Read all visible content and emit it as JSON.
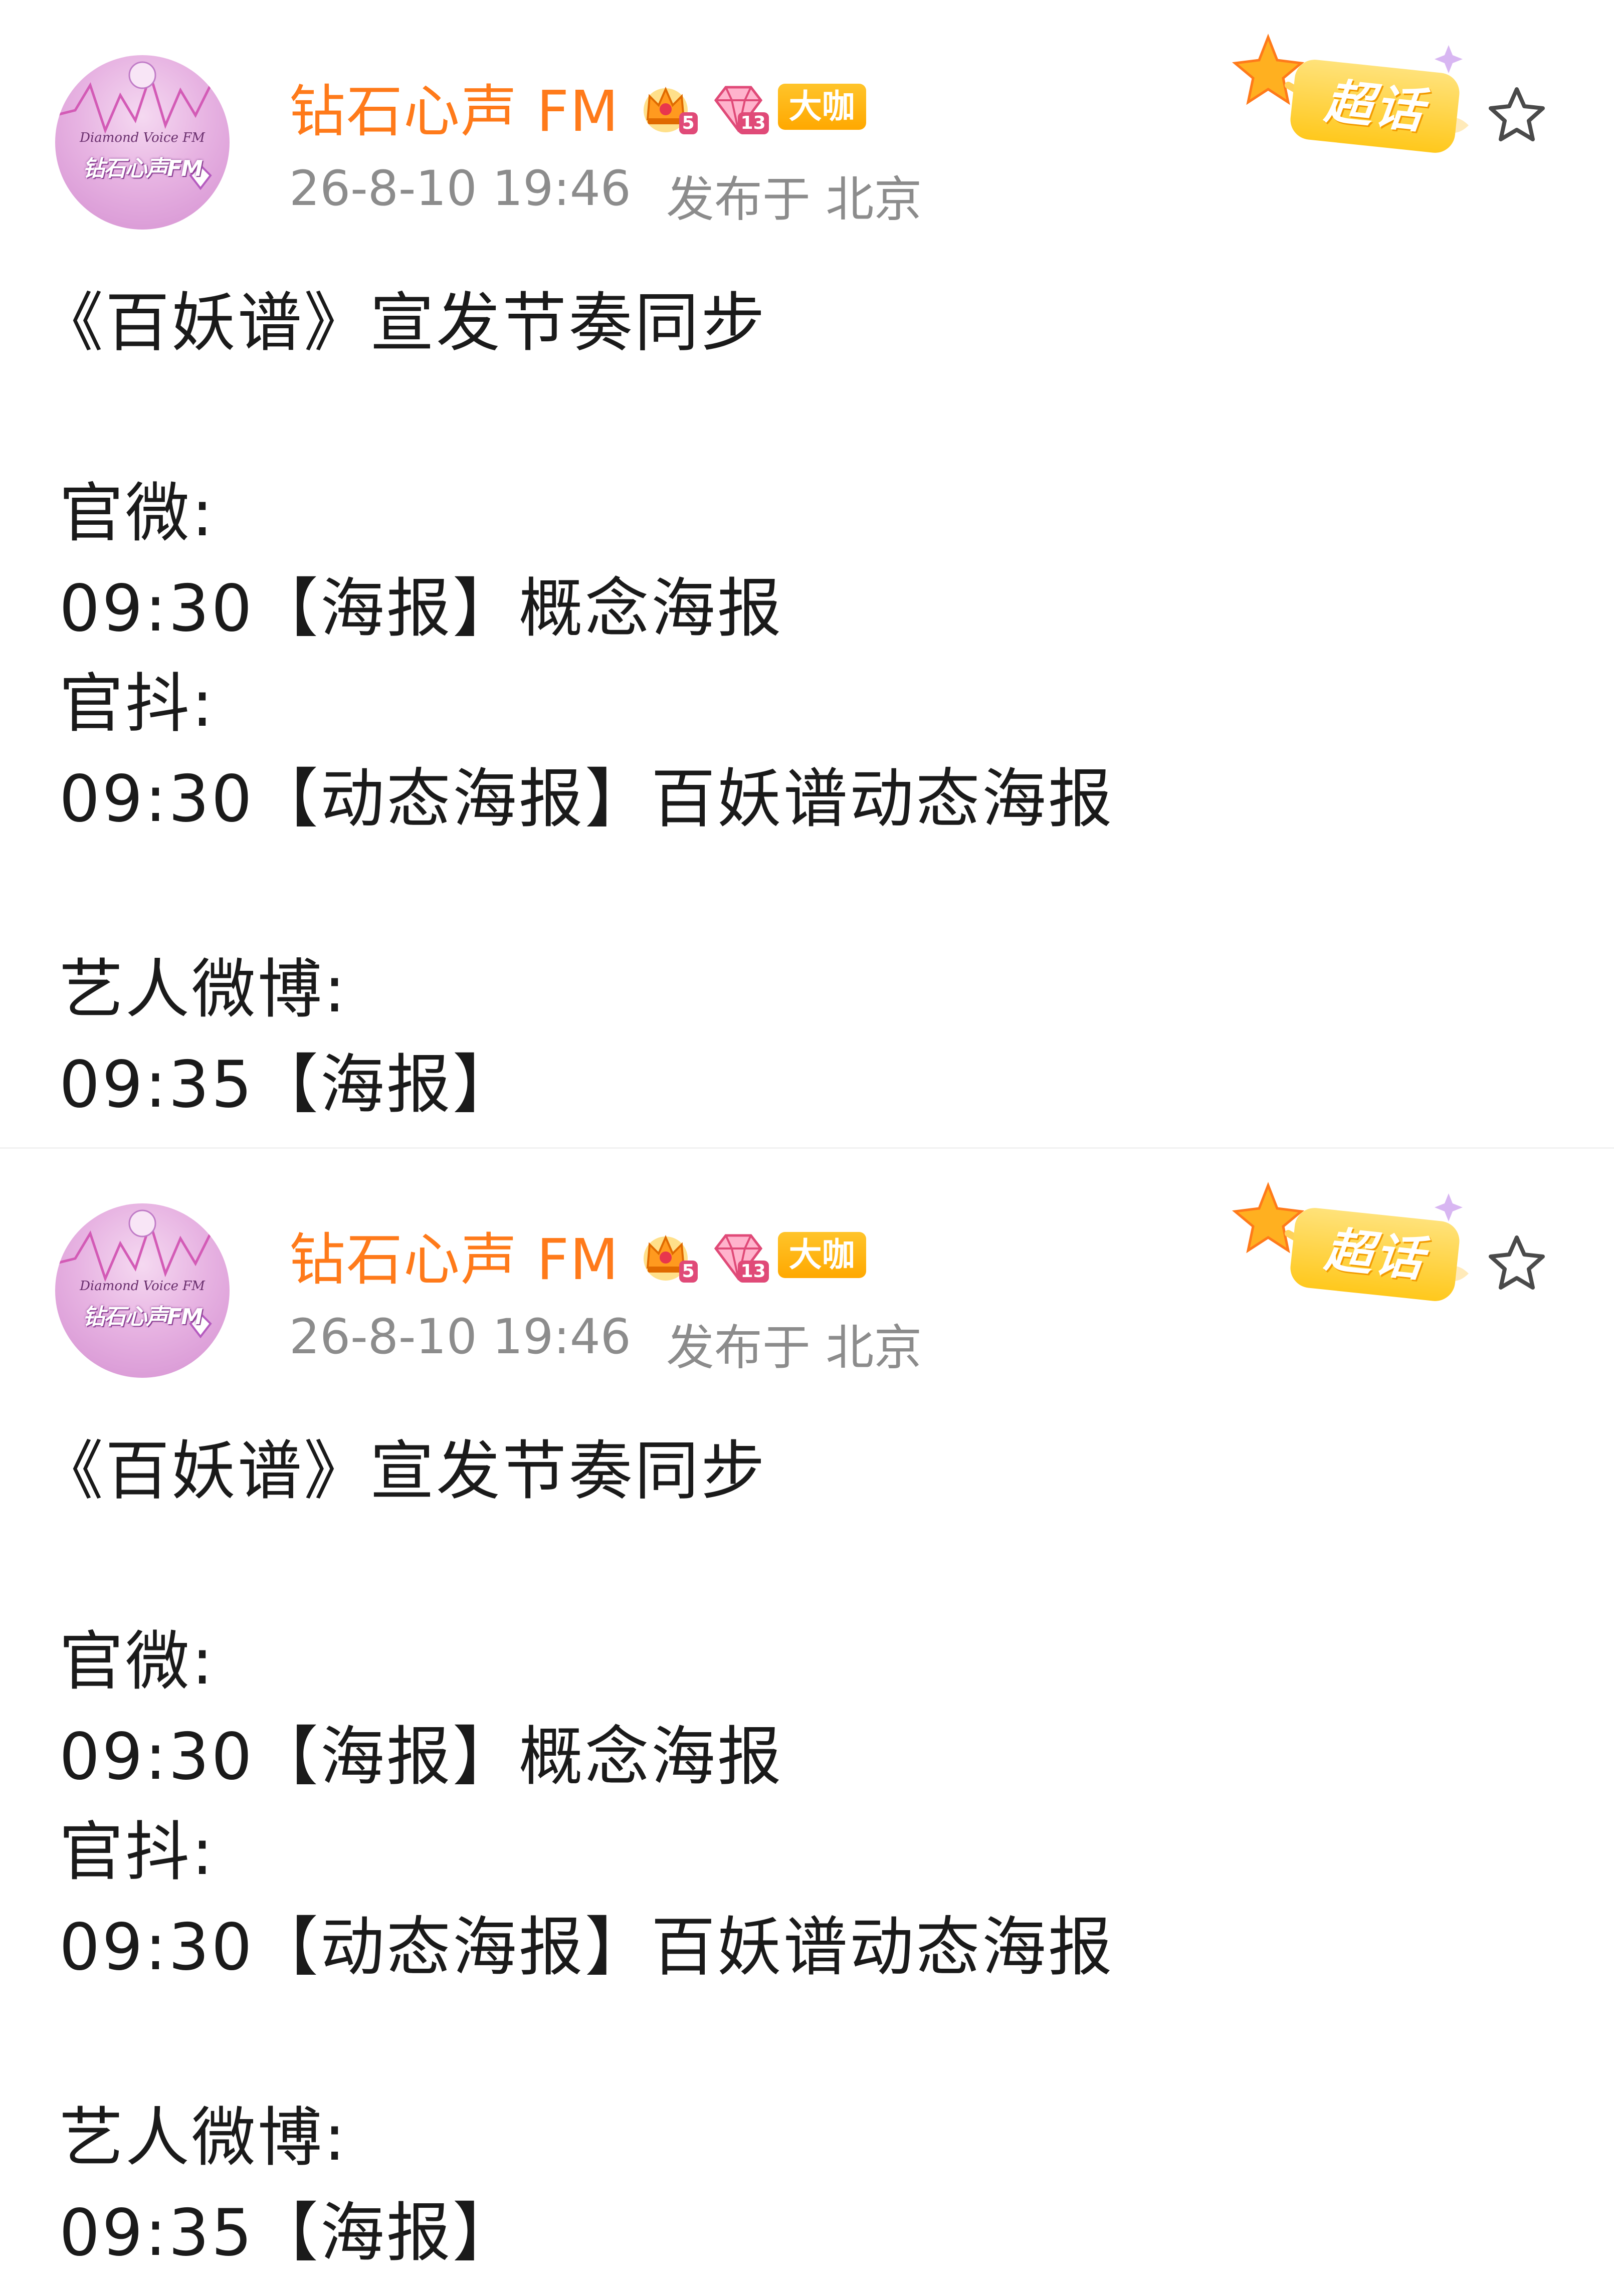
{
  "posts": [
    {
      "author": {
        "name": "钻石心声 FM",
        "avatar_line1": "Diamond Voice FM",
        "avatar_line2": "钻石心声FM",
        "badges": {
          "crown_level": "5",
          "gem_level": "13",
          "daka_label": "大咖"
        }
      },
      "meta": {
        "date": "26-8-10 19:46",
        "location": "发布于 北京"
      },
      "chaohua_label": "超话",
      "content": {
        "title": "《百妖谱》宣发节奏同步",
        "lines": [
          "",
          "官微:",
          "09:30【海报】概念海报",
          "官抖:",
          "09:30【动态海报】百妖谱动态海报",
          "",
          "艺人微博:",
          "09:35【海报】"
        ]
      }
    },
    {
      "author": {
        "name": "钻石心声 FM",
        "avatar_line1": "Diamond Voice FM",
        "avatar_line2": "钻石心声FM",
        "badges": {
          "crown_level": "5",
          "gem_level": "13",
          "daka_label": "大咖"
        }
      },
      "meta": {
        "date": "26-8-10 19:46",
        "location": "发布于 北京"
      },
      "chaohua_label": "超话",
      "content": {
        "title": "《百妖谱》宣发节奏同步",
        "lines": [
          "",
          "官微:",
          "09:30【海报】概念海报",
          "官抖:",
          "09:30【动态海报】百妖谱动态海报",
          "",
          "艺人微博:",
          "09:35【海报】"
        ]
      }
    }
  ],
  "colors": {
    "author_name": "#ff7a1a",
    "meta_text": "#8c8c8c",
    "body_text": "#1a1a1a",
    "daka_badge": "#ffb000",
    "chaohua_badge": "#ffc81c"
  },
  "icons": {
    "crown_badge": "crown-icon",
    "gem_badge": "diamond-icon",
    "favorite": "star-outline-icon",
    "chaohua_decoration": "sparkle-star-icon"
  }
}
